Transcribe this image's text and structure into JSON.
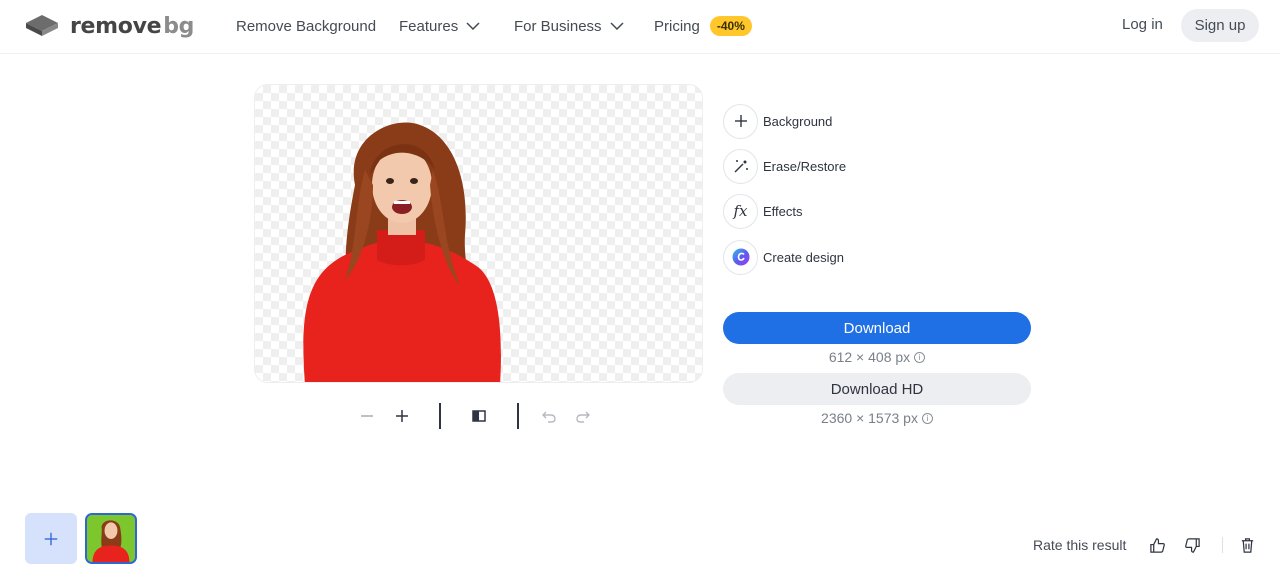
{
  "brand": {
    "logo_main": "remove",
    "logo_suffix": "bg"
  },
  "nav": {
    "remove_background": "Remove Background",
    "features": "Features",
    "for_business": "For Business",
    "pricing": "Pricing",
    "pricing_badge": "-40%",
    "login": "Log in",
    "signup": "Sign up"
  },
  "tools": {
    "background": "Background",
    "erase_restore": "Erase/Restore",
    "effects": "Effects",
    "create_design": "Create design",
    "effects_glyph": "fx"
  },
  "downloads": {
    "download_label": "Download",
    "download_size": "612 × 408 px",
    "download_hd_label": "Download HD",
    "download_hd_size": "2360 × 1573 px"
  },
  "feedback": {
    "rate_label": "Rate this result"
  },
  "colors": {
    "primary": "#1f6fe5",
    "badge": "#ffc72c",
    "thumb_bg": "#76c62b"
  },
  "icons": [
    "zoom-out-icon",
    "zoom-in-icon",
    "compare-icon",
    "undo-icon",
    "redo-icon",
    "plus-icon",
    "magic-wand-icon",
    "canva-icon",
    "info-icon",
    "thumbs-up-icon",
    "thumbs-down-icon",
    "trash-icon"
  ]
}
